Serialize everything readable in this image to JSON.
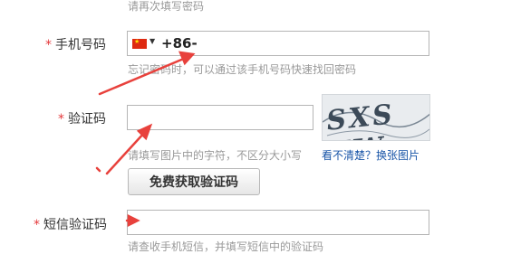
{
  "top_hint": "请再次填写密码",
  "phone": {
    "required_mark": "*",
    "label": "手机号码",
    "country_code": "+86-",
    "hint": "忘记密码时，可以通过该手机号码快速找回密码"
  },
  "captcha": {
    "required_mark": "*",
    "label": "验证码",
    "image_text": "SXS TW",
    "hint": "请填写图片中的字符，不区分大小写",
    "refresh_link": "看不清楚？换张图片",
    "free_button": "免费获取验证码"
  },
  "sms": {
    "required_mark": "*",
    "label": "短信验证码",
    "hint": "请查收手机短信，并填写短信中的验证码"
  },
  "colors": {
    "required": "#e4393c",
    "annotation_arrow": "#e8413c",
    "link": "#1a56a8"
  }
}
